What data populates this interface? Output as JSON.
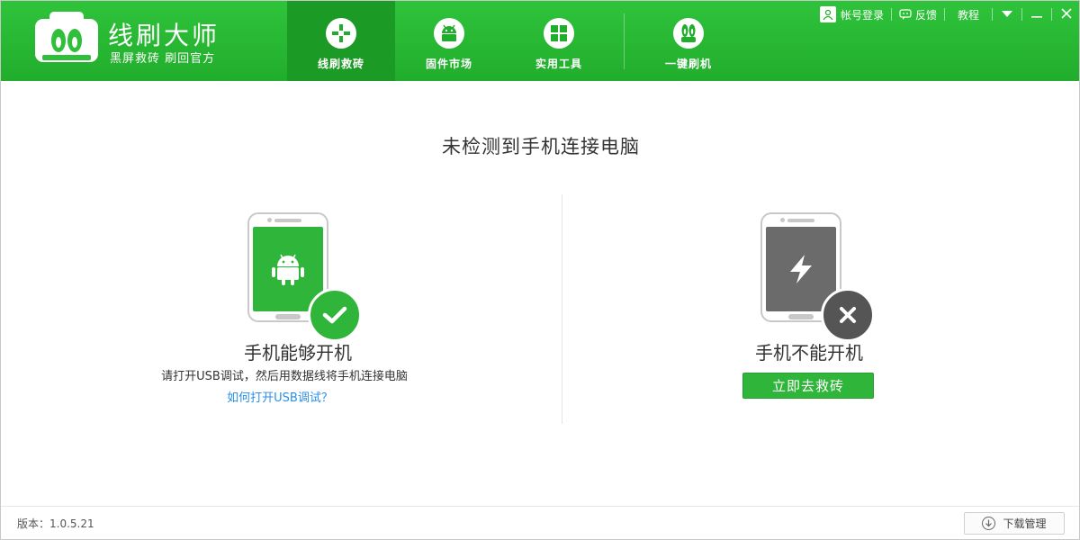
{
  "app": {
    "title": "线刷大师",
    "subtitle": "黑屏救砖 刷回官方"
  },
  "nav": {
    "tabs": [
      {
        "label": "线刷救砖",
        "icon": "plus-grid-icon",
        "active": true
      },
      {
        "label": "固件市场",
        "icon": "android-icon",
        "active": false
      },
      {
        "label": "实用工具",
        "icon": "windows-grid-icon",
        "active": false
      },
      {
        "label": "一键刷机",
        "icon": "rabbit-icon",
        "active": false
      }
    ]
  },
  "topbar": {
    "login_label": "帐号登录",
    "feedback_label": "反馈",
    "tutorial_label": "教程"
  },
  "main": {
    "title": "未检测到手机连接电脑",
    "left": {
      "title": "手机能够开机",
      "desc": "请打开USB调试，然后用数据线将手机连接电脑",
      "link": "如何打开USB调试？"
    },
    "right": {
      "title": "手机不能开机",
      "button": "立即去救砖"
    }
  },
  "footer": {
    "version": "版本：1.0.5.21",
    "download_label": "下载管理"
  },
  "colors": {
    "brand_green": "#21ad2c",
    "active_tab": "#1c9a26",
    "link_blue": "#2a8ee8",
    "dark_phone": "#6b6b6b",
    "badge_dark": "#555555"
  }
}
